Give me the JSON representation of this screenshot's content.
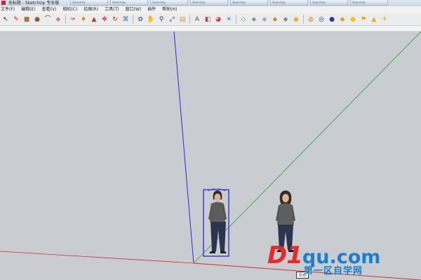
{
  "window": {
    "title": "无标题 - SketchUp 专业版"
  },
  "taskbar_tabs": [
    {
      "label": "SketchUp"
    },
    {
      "label": "SketchUp"
    },
    {
      "label": "SketchUp"
    },
    {
      "label": "SketchUp"
    },
    {
      "label": "SketchUp"
    },
    {
      "label": "SketchUp"
    },
    {
      "label": "SketchUp"
    },
    {
      "label": "SketchUp"
    }
  ],
  "menu": {
    "items": [
      {
        "label": "文件(F)"
      },
      {
        "label": "编辑(E)"
      },
      {
        "label": "查看(V)"
      },
      {
        "label": "相机(C)"
      },
      {
        "label": "绘图(R)"
      },
      {
        "label": "工具(T)"
      },
      {
        "label": "窗口(W)"
      },
      {
        "label": "插件"
      },
      {
        "label": "帮助(H)"
      }
    ]
  },
  "toolbar": {
    "buttons": [
      {
        "name": "select-tool",
        "glyph": "↖",
        "color": "#222222"
      },
      {
        "name": "pencil-tool",
        "glyph": "✎",
        "color": "#cc2222"
      },
      {
        "name": "rectangle-tool",
        "glyph": "■",
        "color": "#b07040"
      },
      {
        "name": "circle-tool",
        "glyph": "●",
        "color": "#8a5a3a"
      },
      {
        "name": "arc-tool",
        "glyph": "⌒",
        "color": "#333333"
      },
      {
        "name": "eraser-tool",
        "glyph": "◆",
        "color": "#d08080"
      },
      {
        "name": "tape-tool",
        "glyph": "✑",
        "color": "#b03030"
      },
      {
        "name": "paint-tool",
        "glyph": "♦",
        "color": "#c89020"
      },
      {
        "name": "pushpull-tool",
        "glyph": "▲",
        "color": "#b04020"
      },
      {
        "name": "move-tool",
        "glyph": "✥",
        "color": "#cc2222"
      },
      {
        "name": "rotate-tool",
        "glyph": "↻",
        "color": "#cc2222"
      },
      {
        "name": "follow-tool",
        "glyph": "⌘",
        "color": "#3a6ab0"
      },
      {
        "name": "orbit-tool",
        "glyph": "✿",
        "color": "#3a6ab0"
      },
      {
        "name": "pan-tool",
        "glyph": "✋",
        "color": "#4a4a4a"
      },
      {
        "name": "zoom-tool",
        "glyph": "⚲",
        "color": "#333333"
      },
      {
        "name": "zoom-extents-tool",
        "glyph": "⤢",
        "color": "#333333"
      },
      {
        "name": "components-tool",
        "glyph": "▤",
        "color": "#c8a030"
      },
      {
        "name": "text-tool",
        "glyph": "A",
        "color": "#555555"
      },
      {
        "name": "section-tool",
        "glyph": "◧",
        "color": "#c04040"
      },
      {
        "name": "materials-tool",
        "glyph": "◕",
        "color": "#c04040"
      },
      {
        "name": "shadows-tool",
        "glyph": "☀",
        "color": "#3a80c0"
      },
      {
        "name": "style-wire-tool",
        "glyph": "◇",
        "color": "#777777"
      },
      {
        "name": "style-hidden-tool",
        "glyph": "◈",
        "color": "#777777"
      },
      {
        "name": "style-shaded-tool",
        "glyph": "◆",
        "color": "#aaaaaa"
      },
      {
        "name": "style-textured-tool",
        "glyph": "◆",
        "color": "#c89040"
      },
      {
        "name": "style-mono-tool",
        "glyph": "◆",
        "color": "#888888"
      },
      {
        "name": "geo-tool",
        "glyph": "◉",
        "color": "#e0a010"
      },
      {
        "name": "warehouse-tool",
        "glyph": "◍",
        "color": "#d09020"
      },
      {
        "name": "share-tool",
        "glyph": "◎",
        "color": "#2a3a90"
      },
      {
        "name": "extension-tool",
        "glyph": "●",
        "color": "#204080"
      },
      {
        "name": "ruby-tool",
        "glyph": "◆",
        "color": "#e0a020"
      },
      {
        "name": "sun-tool",
        "glyph": "●",
        "color": "#f0c020"
      },
      {
        "name": "walk-tool",
        "glyph": "⚑",
        "color": "#e0a020"
      },
      {
        "name": "lookaround-tool",
        "glyph": "▲",
        "color": "#e0b020"
      },
      {
        "name": "position-camera-tool",
        "glyph": "✈",
        "color": "#e0b020"
      }
    ]
  },
  "viewport": {
    "colors": {
      "background": "#c9cdd2",
      "blue_axis": "#2b2bdc",
      "green_axis": "#2e9a3e",
      "red_axis": "#d23030",
      "selection": "#1c1ce0"
    }
  },
  "status": {
    "value_box": "0:0"
  },
  "watermark": {
    "main_d1": "D1",
    "main_rest": "qu.com",
    "sub": "第一区自学网"
  }
}
